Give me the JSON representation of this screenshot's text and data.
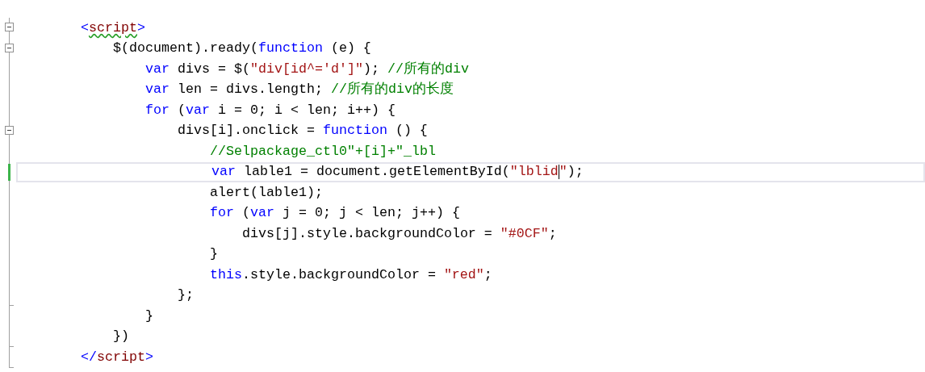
{
  "editor": {
    "lines": [
      {
        "collapsible": true,
        "block_end": false,
        "current": false,
        "changed": false,
        "tokens": [
          {
            "kind": "punct",
            "text": "<"
          },
          {
            "kind": "tag",
            "text": "script",
            "squiggle": true
          },
          {
            "kind": "punct",
            "text": ">"
          }
        ],
        "children": [
          {
            "collapsible": true,
            "block_end": false,
            "current": false,
            "changed": false,
            "tokens": [
              {
                "kind": "plain",
                "text": "$(document).ready("
              },
              {
                "kind": "keyword",
                "text": "function"
              },
              {
                "kind": "plain",
                "text": " (e) {"
              }
            ],
            "children": [
              {
                "collapsible": false,
                "block_end": false,
                "current": false,
                "changed": false,
                "tokens": [
                  {
                    "kind": "keyword",
                    "text": "var"
                  },
                  {
                    "kind": "plain",
                    "text": " divs = $("
                  },
                  {
                    "kind": "string",
                    "text": "\"div[id^='d']\""
                  },
                  {
                    "kind": "plain",
                    "text": "); "
                  },
                  {
                    "kind": "comment",
                    "text": "//所有的div"
                  }
                ]
              },
              {
                "collapsible": false,
                "block_end": false,
                "current": false,
                "changed": false,
                "tokens": [
                  {
                    "kind": "keyword",
                    "text": "var"
                  },
                  {
                    "kind": "plain",
                    "text": " len = divs.length; "
                  },
                  {
                    "kind": "comment",
                    "text": "//所有的div的长度"
                  }
                ]
              },
              {
                "collapsible": false,
                "block_end": false,
                "current": false,
                "changed": false,
                "tokens": [
                  {
                    "kind": "keyword",
                    "text": "for"
                  },
                  {
                    "kind": "plain",
                    "text": " ("
                  },
                  {
                    "kind": "keyword",
                    "text": "var"
                  },
                  {
                    "kind": "plain",
                    "text": " i = 0; i < len; i++) {"
                  }
                ],
                "children": [
                  {
                    "collapsible": true,
                    "block_end": false,
                    "current": false,
                    "changed": false,
                    "tokens": [
                      {
                        "kind": "plain",
                        "text": "divs[i].onclick = "
                      },
                      {
                        "kind": "keyword",
                        "text": "function"
                      },
                      {
                        "kind": "plain",
                        "text": " () {"
                      }
                    ],
                    "children": [
                      {
                        "collapsible": false,
                        "block_end": false,
                        "current": false,
                        "changed": false,
                        "tokens": [
                          {
                            "kind": "comment",
                            "text": "//Selpackage_ctl0\"+[i]+\"_lbl"
                          }
                        ]
                      },
                      {
                        "collapsible": false,
                        "block_end": false,
                        "current": true,
                        "changed": true,
                        "tokens": [
                          {
                            "kind": "keyword",
                            "text": "var"
                          },
                          {
                            "kind": "plain",
                            "text": " lable1 = document.getElementById("
                          },
                          {
                            "kind": "string",
                            "text": "\"lblid",
                            "caret": true
                          },
                          {
                            "kind": "string",
                            "text": "\""
                          },
                          {
                            "kind": "plain",
                            "text": ");"
                          }
                        ]
                      },
                      {
                        "collapsible": false,
                        "block_end": false,
                        "current": false,
                        "changed": false,
                        "tokens": [
                          {
                            "kind": "plain",
                            "text": "alert(lable1);"
                          }
                        ]
                      },
                      {
                        "collapsible": false,
                        "block_end": false,
                        "current": false,
                        "changed": false,
                        "tokens": [
                          {
                            "kind": "keyword",
                            "text": "for"
                          },
                          {
                            "kind": "plain",
                            "text": " ("
                          },
                          {
                            "kind": "keyword",
                            "text": "var"
                          },
                          {
                            "kind": "plain",
                            "text": " j = 0; j < len; j++) {"
                          }
                        ],
                        "children": [
                          {
                            "collapsible": false,
                            "block_end": false,
                            "current": false,
                            "changed": false,
                            "tokens": [
                              {
                                "kind": "plain",
                                "text": "divs[j].style.backgroundColor = "
                              },
                              {
                                "kind": "string",
                                "text": "\"#0CF\""
                              },
                              {
                                "kind": "plain",
                                "text": ";"
                              }
                            ]
                          }
                        ]
                      },
                      {
                        "collapsible": false,
                        "block_end": false,
                        "current": false,
                        "changed": false,
                        "tokens": [
                          {
                            "kind": "plain",
                            "text": "}"
                          }
                        ]
                      },
                      {
                        "collapsible": false,
                        "block_end": false,
                        "current": false,
                        "changed": false,
                        "tokens": [
                          {
                            "kind": "keyword",
                            "text": "this"
                          },
                          {
                            "kind": "plain",
                            "text": ".style.backgroundColor = "
                          },
                          {
                            "kind": "string",
                            "text": "\"red\""
                          },
                          {
                            "kind": "plain",
                            "text": ";"
                          }
                        ]
                      }
                    ]
                  },
                  {
                    "collapsible": false,
                    "block_end": true,
                    "current": false,
                    "changed": false,
                    "tokens": [
                      {
                        "kind": "plain",
                        "text": "};"
                      }
                    ]
                  }
                ]
              },
              {
                "collapsible": false,
                "block_end": false,
                "current": false,
                "changed": false,
                "tokens": [
                  {
                    "kind": "plain",
                    "text": "}"
                  }
                ]
              }
            ]
          },
          {
            "collapsible": false,
            "block_end": true,
            "current": false,
            "changed": false,
            "tokens": [
              {
                "kind": "plain",
                "text": "})"
              }
            ]
          }
        ]
      },
      {
        "collapsible": false,
        "block_end": true,
        "current": false,
        "changed": false,
        "tokens": [
          {
            "kind": "punct",
            "text": "</"
          },
          {
            "kind": "tag",
            "text": "script"
          },
          {
            "kind": "punct",
            "text": ">"
          }
        ]
      }
    ]
  }
}
